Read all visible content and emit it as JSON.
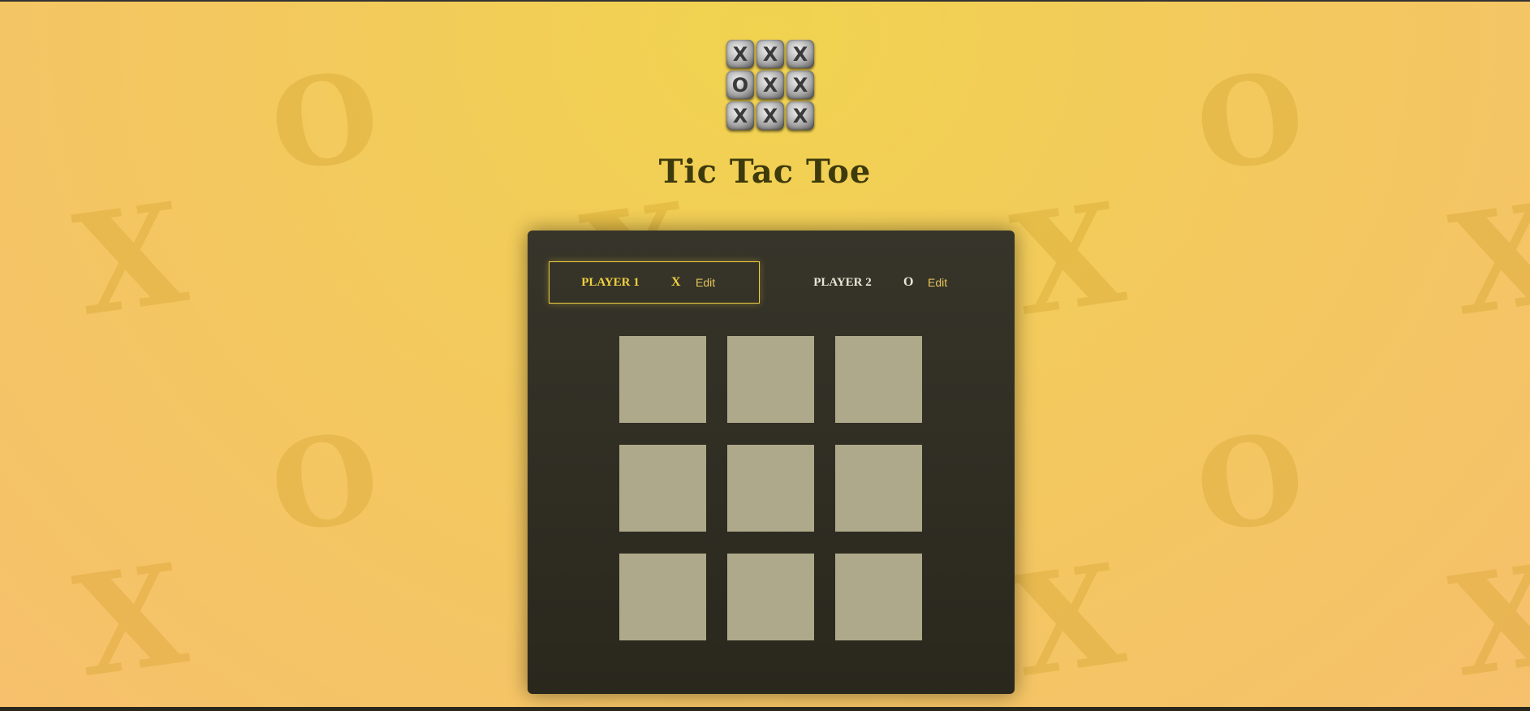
{
  "app": {
    "title": "Tic Tac Toe"
  },
  "logo": {
    "icon": "tic-tac-toe-logo-icon",
    "tiles": [
      "X",
      "X",
      "X",
      "O",
      "X",
      "X",
      "X",
      "X",
      "X"
    ]
  },
  "players": [
    {
      "name": "PLAYER 1",
      "symbol": "X",
      "edit_label": "Edit",
      "active": true
    },
    {
      "name": "PLAYER 2",
      "symbol": "O",
      "edit_label": "Edit",
      "active": false
    }
  ],
  "board": {
    "cells": [
      "",
      "",
      "",
      "",
      "",
      "",
      "",
      "",
      ""
    ]
  },
  "colors": {
    "accent": "#f1d13f",
    "panel": "#2f2d22",
    "cell": "#aea98a",
    "title": "#3d3a0c"
  }
}
